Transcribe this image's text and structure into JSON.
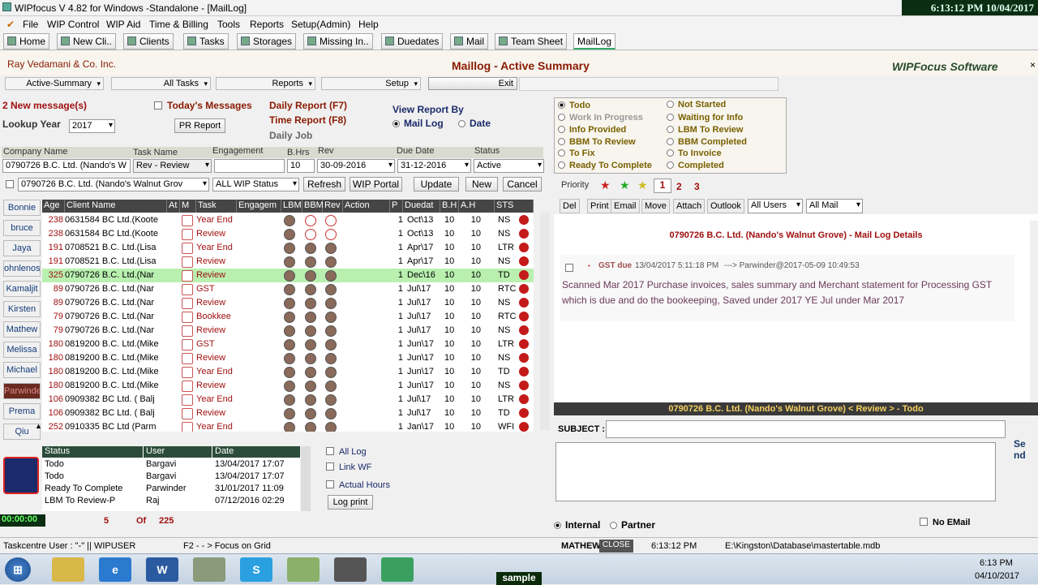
{
  "window": {
    "title": "WIPfocus V 4.82 for Windows -Standalone - [MailLog]",
    "clock": "6:13:12 PM 10/04/2017"
  },
  "menu": [
    "File",
    "WIP Control",
    "WIP Aid",
    "Time & Billing",
    "Tools",
    "Reports",
    "Setup(Admin)",
    "Help"
  ],
  "toolbar": [
    "Home",
    "New Cli..",
    "Clients",
    "Tasks",
    "Storages",
    "Missing In..",
    "Duedates",
    "Mail",
    "Team Sheet",
    "MailLog"
  ],
  "header": {
    "company": "Ray Vedamani & Co. Inc.",
    "title": "Maillog - Active Summary",
    "brand": "WIPFocus Software"
  },
  "dropdowns": {
    "view": "Active-Summary",
    "tasks": "All Tasks",
    "reports": "Reports",
    "setup": "Setup",
    "exit": "Exit"
  },
  "left": {
    "new_messages": "2 New message(s)",
    "lookup_label": "Lookup Year",
    "lookup_year": "2017",
    "today_messages": "Today's Messages",
    "pr_report": "PR Report",
    "daily_report": "Daily Report (F7)",
    "time_report": "Time Report (F8)",
    "daily_job": "Daily Job",
    "view_by": "View Report By",
    "mail_log": "Mail Log",
    "date": "Date"
  },
  "status_options": [
    {
      "label": "Todo",
      "on": true,
      "dis": false
    },
    {
      "label": "Not Started",
      "on": false,
      "dis": false
    },
    {
      "label": "Work In Progress",
      "on": false,
      "dis": true
    },
    {
      "label": "Waiting for Info",
      "on": false,
      "dis": false
    },
    {
      "label": "Info Provided",
      "on": false,
      "dis": false
    },
    {
      "label": "LBM To Review",
      "on": false,
      "dis": false
    },
    {
      "label": "BBM To Review",
      "on": false,
      "dis": false
    },
    {
      "label": "BBM Completed",
      "on": false,
      "dis": false
    },
    {
      "label": "To Fix",
      "on": false,
      "dis": false
    },
    {
      "label": "To Invoice",
      "on": false,
      "dis": false
    },
    {
      "label": "Ready To Complete",
      "on": false,
      "dis": false
    },
    {
      "label": "Completed",
      "on": false,
      "dis": false
    }
  ],
  "filters": {
    "company_label": "Company Name",
    "task_label": "Task Name",
    "engagement_label": "Engagement",
    "bhrs_label": "B.Hrs",
    "rev_label": "Rev",
    "due_label": "Due Date",
    "status_label": "Status",
    "company": "0790726 B.C. Ltd. (Nando's W",
    "task": "Rev - Review",
    "engagement": "",
    "bhrs": "10",
    "rev": "30-09-2016",
    "due": "31-12-2016",
    "status": "Active",
    "company2": "0790726 B.C. Ltd. (Nando's Walnut Grov",
    "wip_status": "ALL WIP Status",
    "refresh": "Refresh",
    "wip_portal": "WIP Portal",
    "update": "Update",
    "new": "New",
    "cancel": "Cancel"
  },
  "priority": {
    "label": "Priority",
    "pages": [
      "1",
      "2",
      "3"
    ]
  },
  "staff": [
    "Bonnie",
    "bruce",
    "Jaya",
    "ohnlenos",
    "Kamaljit",
    "Kirsten",
    "Mathew",
    "Melissa",
    "Michael",
    "Parwinde",
    "Prema",
    "Qiu"
  ],
  "grid": {
    "headers": [
      "Age",
      "Client Name",
      "At",
      "M",
      "Task",
      "Engagem",
      "LBM",
      "BBM",
      "Rev",
      "Action",
      "P",
      "Duedat",
      "B.H",
      "A.H",
      "STS"
    ],
    "rows": [
      [
        "238",
        "0631584 BC Ltd.(Koote",
        "Year End",
        "1",
        "Oct\\13",
        "10",
        "10",
        "NS",
        false
      ],
      [
        "238",
        "0631584 BC Ltd.(Koote",
        "Review",
        "1",
        "Oct\\13",
        "10",
        "10",
        "NS",
        false
      ],
      [
        "191",
        "0708521 B.C. Ltd.(Lisa",
        "Year End",
        "1",
        "Apr\\17",
        "10",
        "10",
        "LTR",
        false
      ],
      [
        "191",
        "0708521 B.C. Ltd.(Lisa",
        "Review",
        "1",
        "Apr\\17",
        "10",
        "10",
        "NS",
        false
      ],
      [
        "325",
        "0790726 B.C. Ltd.(Nar",
        "Review",
        "1",
        "Dec\\16",
        "10",
        "10",
        "TD",
        true
      ],
      [
        "89",
        "0790726 B.C. Ltd.(Nar",
        "GST",
        "1",
        "Jul\\17",
        "10",
        "10",
        "RTC",
        false
      ],
      [
        "89",
        "0790726 B.C. Ltd.(Nar",
        "Review",
        "1",
        "Jul\\17",
        "10",
        "10",
        "NS",
        false
      ],
      [
        "79",
        "0790726 B.C. Ltd.(Nar",
        "Bookkee",
        "1",
        "Jul\\17",
        "10",
        "10",
        "RTC",
        false
      ],
      [
        "79",
        "0790726 B.C. Ltd.(Nar",
        "Review",
        "1",
        "Jul\\17",
        "10",
        "10",
        "NS",
        false
      ],
      [
        "180",
        "0819200 B.C. Ltd.(Mike",
        "GST",
        "1",
        "Jun\\17",
        "10",
        "10",
        "LTR",
        false
      ],
      [
        "180",
        "0819200 B.C. Ltd.(Mike",
        "Review",
        "1",
        "Jun\\17",
        "10",
        "10",
        "NS",
        false
      ],
      [
        "180",
        "0819200 B.C. Ltd.(Mike",
        "Year End",
        "1",
        "Jun\\17",
        "10",
        "10",
        "TD",
        false
      ],
      [
        "180",
        "0819200 B.C. Ltd.(Mike",
        "Review",
        "1",
        "Jun\\17",
        "10",
        "10",
        "NS",
        false
      ],
      [
        "106",
        "0909382 BC Ltd. ( Balj",
        "Year End",
        "1",
        "Jul\\17",
        "10",
        "10",
        "LTR",
        false
      ],
      [
        "106",
        "0909382 BC Ltd. ( Balj",
        "Review",
        "1",
        "Jul\\17",
        "10",
        "10",
        "TD",
        false
      ],
      [
        "252",
        "0910335 BC Ltd (Parm",
        "Year End",
        "1",
        "Jan\\17",
        "10",
        "10",
        "WFI",
        false
      ]
    ]
  },
  "history": {
    "headers": [
      "Status",
      "User",
      "Date"
    ],
    "rows": [
      [
        "Todo",
        "Bargavi",
        "13/04/2017 17:07"
      ],
      [
        "Todo",
        "Bargavi",
        "13/04/2017 17:07"
      ],
      [
        "Ready To Complete",
        "Parwinder",
        "31/01/2017 11:09"
      ],
      [
        "LBM To Review-P",
        "Raj",
        "07/12/2016 02:29"
      ]
    ]
  },
  "log_opts": {
    "all_log": "All Log",
    "link_wf": "Link WF",
    "actual_hours": "Actual Hours",
    "log_print": "Log print"
  },
  "counter": {
    "time": "00:00:00",
    "current": "5",
    "of": "Of",
    "total": "225"
  },
  "mail_tools": [
    "Del",
    "Print",
    "Email",
    "Move",
    "Attach",
    "Outlook"
  ],
  "mail_filters": {
    "users": "All Users",
    "mail": "All Mail"
  },
  "detail": {
    "title": "0790726 B.C. Ltd. (Nando's Walnut Grove) - Mail Log Details",
    "entry_head": "GST due",
    "entry_date": "13/04/2017 5:11:18 PM",
    "entry_to": "---> Parwinder@2017-05-09 10:49:53",
    "body": "Scanned Mar 2017 Purchase invoices, sales summary and Merchant statement for Processing GST which is due and do the bookeeping, Saved under 2017 YE Jul under Mar 2017"
  },
  "banner": "0790726 B.C. Ltd. (Nando's Walnut Grove) < Review >  - Todo",
  "compose": {
    "subject_label": "SUBJECT :",
    "send": "Send",
    "internal": "Internal",
    "partner": "Partner",
    "no_email": "No EMail"
  },
  "statusbar": {
    "taskcentre": "Taskcentre User : \"-\"   ||  WIPUSER",
    "hint": "F2 - - > Focus on Grid",
    "user": "MATHEW",
    "close": "CLOSE",
    "time": "6:13:12 PM",
    "path": "E:\\Kingston\\Database\\mastertable.mdb"
  },
  "tray": {
    "time": "6:13 PM",
    "date": "04/10/2017",
    "watermark": "sample"
  },
  "colors": {
    "selected_row": "#b9f0b0",
    "banner_bg": "#3a3a3a",
    "accent_red": "#a01010"
  }
}
